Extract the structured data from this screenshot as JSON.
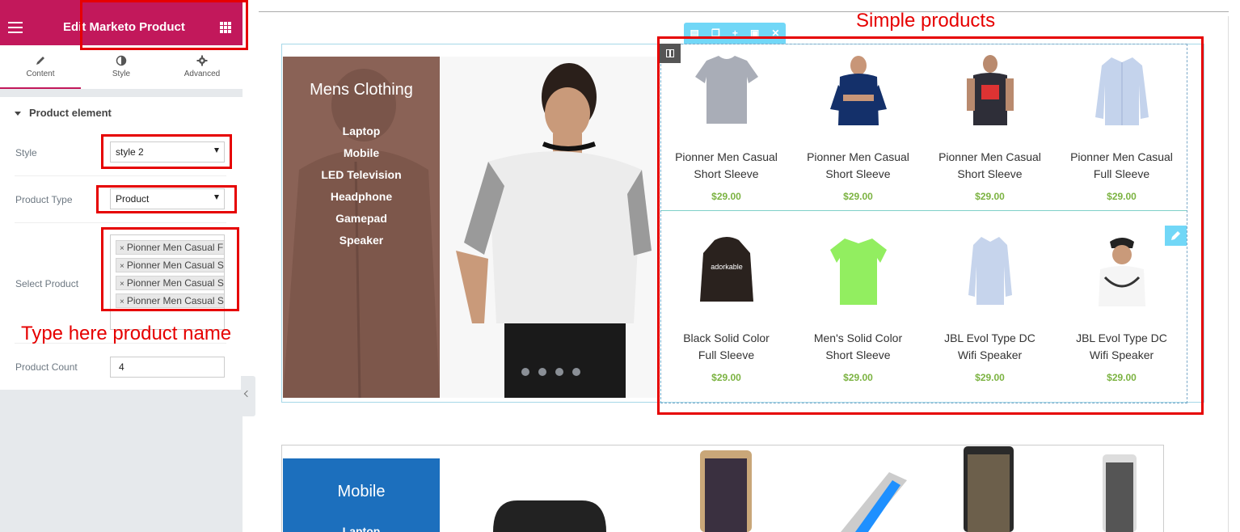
{
  "editor": {
    "title": "Edit Marketo Product",
    "tabs": [
      {
        "label": "Content",
        "icon": "pencil-icon",
        "active": true
      },
      {
        "label": "Style",
        "icon": "contrast-icon",
        "active": false
      },
      {
        "label": "Advanced",
        "icon": "gear-icon",
        "active": false
      }
    ],
    "section_title": "Product element",
    "fields": {
      "style_label": "Style",
      "style_value": "style 2",
      "product_type_label": "Product Type",
      "product_type_value": "Product",
      "select_product_label": "Select Product",
      "selected_products": [
        "Pionner Men Casual Full Sleeve",
        "Pionner Men Casual Short Sleeve",
        "Pionner Men Casual Short Sleeve",
        "Pionner Men Casual Short Sleeve"
      ],
      "product_count_label": "Product Count",
      "product_count_value": "4"
    }
  },
  "annotations": {
    "simple_products": "Simple products",
    "type_here": "Type here product name"
  },
  "banner": {
    "heading": "Mens Clothing",
    "items": [
      "Laptop",
      "Mobile",
      "LED Television",
      "Headphone",
      "Gamepad",
      "Speaker"
    ]
  },
  "products": [
    {
      "name_line1": "Pionner Men Casual",
      "name_line2": "Short Sleeve",
      "price": "$29.00",
      "image": "grey-tshirt"
    },
    {
      "name_line1": "Pionner Men Casual",
      "name_line2": "Short Sleeve",
      "price": "$29.00",
      "image": "navy-polo-man"
    },
    {
      "name_line1": "Pionner Men Casual",
      "name_line2": "Short Sleeve",
      "price": "$29.00",
      "image": "graphic-tee-man"
    },
    {
      "name_line1": "Pionner Men Casual",
      "name_line2": "Full Sleeve",
      "price": "$29.00",
      "image": "blue-shirt"
    },
    {
      "name_line1": "Black Solid Color",
      "name_line2": "Full Sleeve",
      "price": "$29.00",
      "image": "black-hoodie"
    },
    {
      "name_line1": "Men's Solid Color",
      "name_line2": "Short Sleeve",
      "price": "$29.00",
      "image": "green-polo"
    },
    {
      "name_line1": "JBL Evol Type DC",
      "name_line2": "Wifi Speaker",
      "price": "$29.00",
      "image": "blue-shirt"
    },
    {
      "name_line1": "JBL Evol Type DC",
      "name_line2": "Wifi Speaker",
      "price": "$29.00",
      "image": "man-cap-tee"
    }
  ],
  "hoodie_print": "adorkable",
  "banner2": {
    "heading": "Mobile",
    "first_item": "Laptop"
  },
  "colors": {
    "brand": "#c2185b",
    "annotation": "#e60000",
    "price": "#7cb342",
    "edit_accent": "#71d7f7"
  }
}
